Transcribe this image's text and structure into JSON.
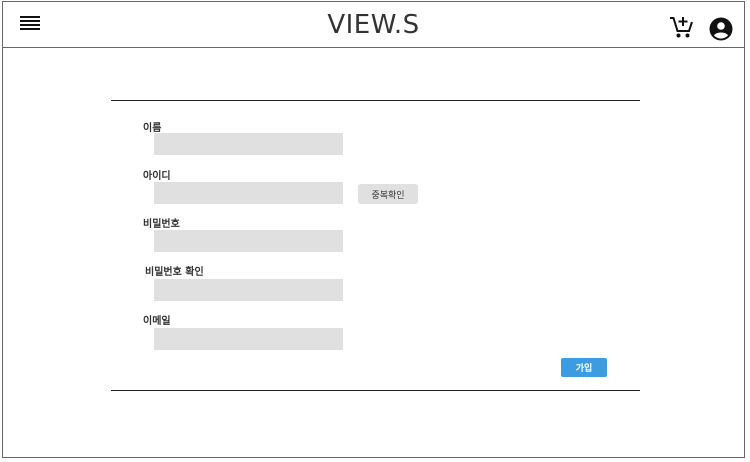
{
  "header": {
    "brand": "VIEW.S",
    "menu_icon": "hamburger-menu-icon",
    "cart_icon": "add-shopping-cart-icon",
    "account_icon": "account-circle-icon"
  },
  "form": {
    "name_label": "이름",
    "id_label": "아이디",
    "password_label": "비밀번호",
    "password_confirm_label": "비밀번호 확인",
    "email_label": "이메일",
    "name_value": "",
    "id_value": "",
    "password_value": "",
    "password_confirm_value": "",
    "email_value": "",
    "duplicate_check_label": "중복확인",
    "submit_label": "가입"
  },
  "colors": {
    "accent": "#3d9be0",
    "input_bg": "#e0e0e0",
    "rule": "#222222"
  }
}
